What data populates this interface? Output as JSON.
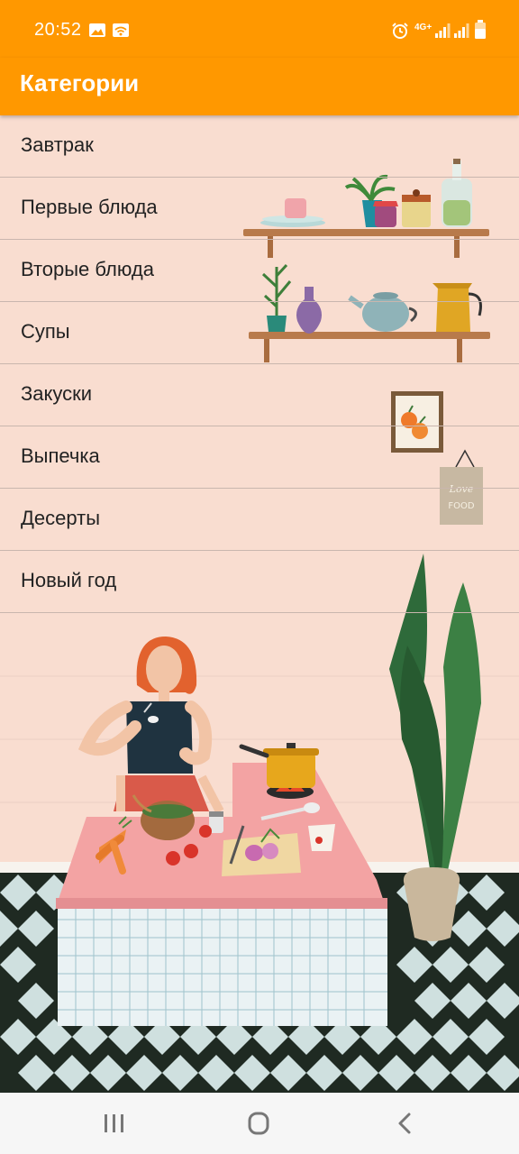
{
  "status_bar": {
    "time": "20:52",
    "network_label": "4G+",
    "icons": [
      "image-icon",
      "wifi-hotspot-icon",
      "alarm-icon",
      "signal-icon",
      "signal-icon",
      "battery-icon"
    ]
  },
  "app_bar": {
    "title": "Категории"
  },
  "categories": [
    "Завтрак",
    "Первые блюда",
    "Вторые блюда",
    "Супы",
    "Закуски",
    "Выпечка",
    "Десерты",
    "Новый год"
  ],
  "decor": {
    "sign_text_1": "Love",
    "sign_text_2": "FOOD"
  },
  "nav_bar": {
    "buttons": [
      "recent-apps-icon",
      "home-icon",
      "back-icon"
    ]
  },
  "colors": {
    "accent": "#ff9800",
    "background": "#f9ddd0",
    "divider": "#c9b6ae"
  }
}
